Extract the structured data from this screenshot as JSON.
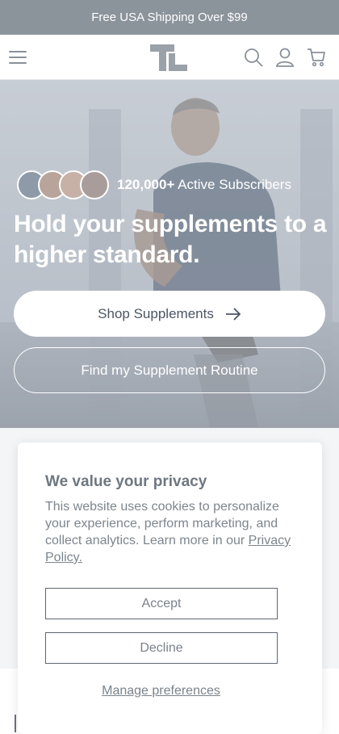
{
  "announcement": {
    "text": "Free USA Shipping Over $99"
  },
  "header": {
    "icons": [
      "menu-icon",
      "logo",
      "search-icon",
      "account-icon",
      "cart-icon"
    ],
    "colors": {
      "icon": "#8a9099",
      "logo": "#9aa1a9"
    }
  },
  "hero": {
    "subscribers_count": "120,000+",
    "subscribers_label": " Active Subscribers",
    "title": "Hold your supplements to a higher standard.",
    "primary_button": "Shop Supplements",
    "secondary_button": "Find my Supplement Routine"
  },
  "consent": {
    "title": "We value your privacy",
    "body": "This website uses cookies to personalize your experience, perform marketing, and collect analytics. Learn more in our ",
    "link": "Privacy Policy.",
    "accept": "Accept",
    "decline": "Decline",
    "manage": "Manage preferences"
  }
}
